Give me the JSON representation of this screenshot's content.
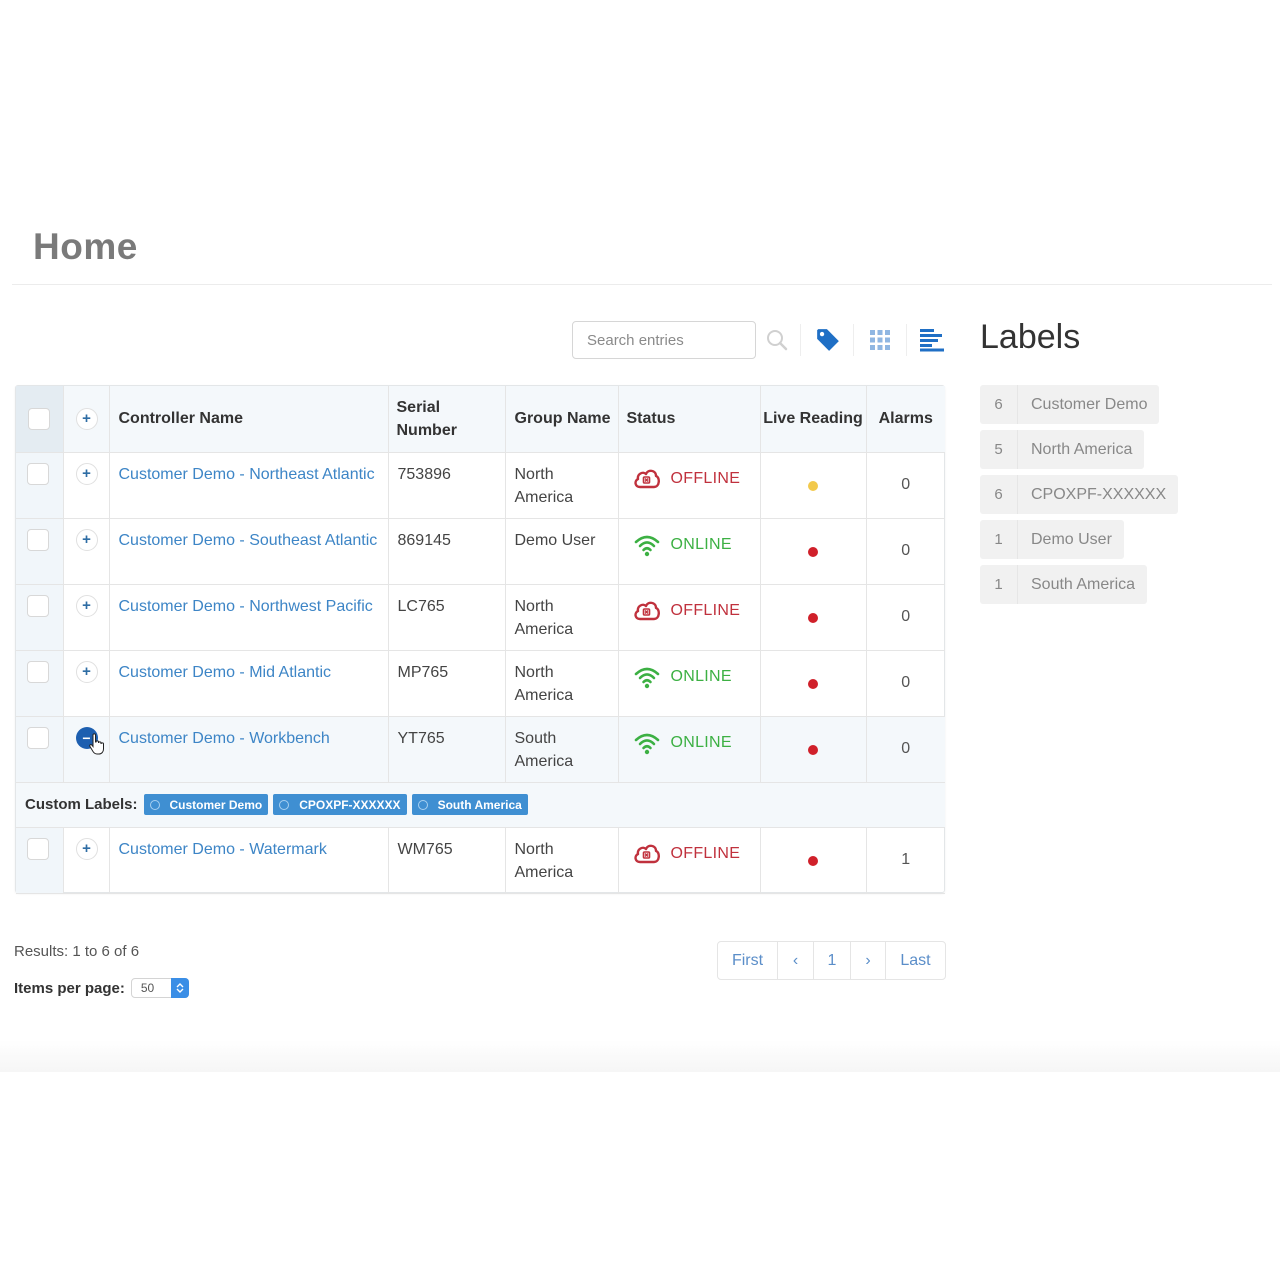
{
  "page": {
    "title": "Home"
  },
  "toolbar": {
    "search_placeholder": "Search entries",
    "search_value": "",
    "icons": [
      "search-icon",
      "tag-icon",
      "grid-view-icon",
      "list-view-icon"
    ]
  },
  "table": {
    "columns": {
      "controller_name": "Controller Name",
      "serial_number": "Serial Number",
      "group_name": "Group Name",
      "status": "Status",
      "live_reading": "Live Reading",
      "alarms": "Alarms"
    },
    "rows": [
      {
        "name": "Customer Demo - Northeast Atlantic",
        "serial": "753896",
        "group": "North America",
        "status": "OFFLINE",
        "status_kind": "offline",
        "live_color": "#f2c94c",
        "alarms": "0",
        "expanded": false
      },
      {
        "name": "Customer Demo - Southeast Atlantic",
        "serial": "869145",
        "group": "Demo User",
        "status": "ONLINE",
        "status_kind": "online",
        "live_color": "#d0202a",
        "alarms": "0",
        "expanded": false
      },
      {
        "name": "Customer Demo - Northwest Pacific",
        "serial": "LC765",
        "group": "North America",
        "status": "OFFLINE",
        "status_kind": "offline",
        "live_color": "#d0202a",
        "alarms": "0",
        "expanded": false
      },
      {
        "name": "Customer Demo - Mid Atlantic",
        "serial": "MP765",
        "group": "North America",
        "status": "ONLINE",
        "status_kind": "online",
        "live_color": "#d0202a",
        "alarms": "0",
        "expanded": false
      },
      {
        "name": "Customer Demo - Workbench",
        "serial": "YT765",
        "group": "South America",
        "status": "ONLINE",
        "status_kind": "online",
        "live_color": "#d0202a",
        "alarms": "0",
        "expanded": true
      },
      {
        "name": "Customer Demo - Watermark",
        "serial": "WM765",
        "group": "North America",
        "status": "OFFLINE",
        "status_kind": "offline",
        "live_color": "#d0202a",
        "alarms": "1",
        "expanded": false
      }
    ],
    "custom_labels": {
      "caption": "Custom Labels:",
      "tags": [
        "Customer Demo",
        "CPOXPF-XXXXXX",
        "South America"
      ]
    }
  },
  "footer": {
    "results_text": "Results: 1 to 6 of 6",
    "items_per_page_label": "Items per page:",
    "items_per_page_value": "50",
    "pagination": {
      "first": "First",
      "prev": "‹",
      "current": "1",
      "next": "›",
      "last": "Last"
    }
  },
  "labels_panel": {
    "title": "Labels",
    "items": [
      {
        "count": "6",
        "name": "Customer Demo"
      },
      {
        "count": "5",
        "name": "North America"
      },
      {
        "count": "6",
        "name": "CPOXPF-XXXXXX"
      },
      {
        "count": "1",
        "name": "Demo User"
      },
      {
        "count": "1",
        "name": "South America"
      }
    ]
  },
  "colors": {
    "link": "#3d85c6",
    "offline": "#c0313d",
    "online": "#3cb043",
    "tag_bg": "#3f8fd2",
    "accent": "#1d5fb0"
  }
}
